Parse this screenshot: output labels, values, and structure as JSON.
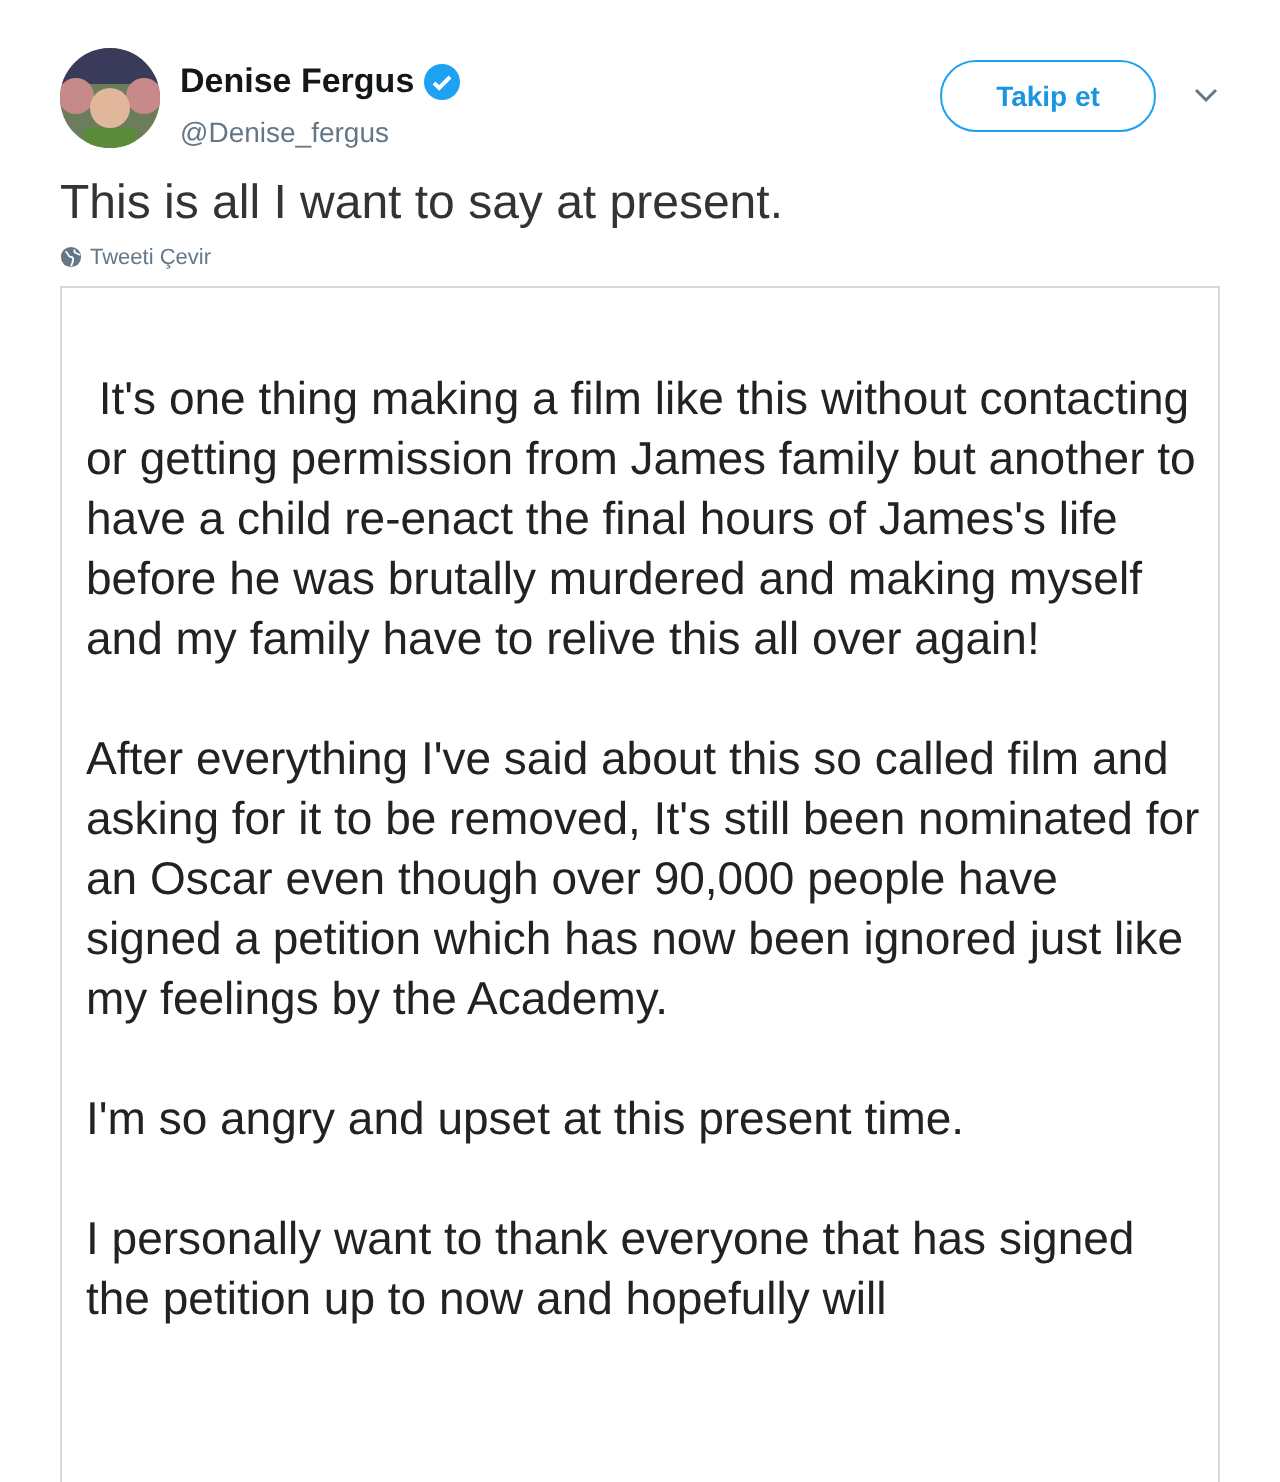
{
  "author": {
    "name": "Denise Fergus",
    "verified": true,
    "handle": "@Denise_fergus"
  },
  "follow_button": "Takip et",
  "tweet_text": "This is all I want to say at present.",
  "translate_link": "Tweeti Çevir",
  "attached_image": {
    "paragraphs": [
      " It's one thing making a film like this without contacting or getting permission from James family but another to have a child re-enact the final hours of James's life before he was brutally murdered and making myself and my family have to relive this all over again!",
      "After everything I've said about this so called film and asking for it to be removed, It's still been nominated for an Oscar even though over 90,000 people have signed a petition which has now been ignored just like my feelings by the Academy.",
      "I'm so angry and upset at this present time.",
      "I personally want to thank everyone that has signed the petition up to now and hopefully will"
    ]
  }
}
